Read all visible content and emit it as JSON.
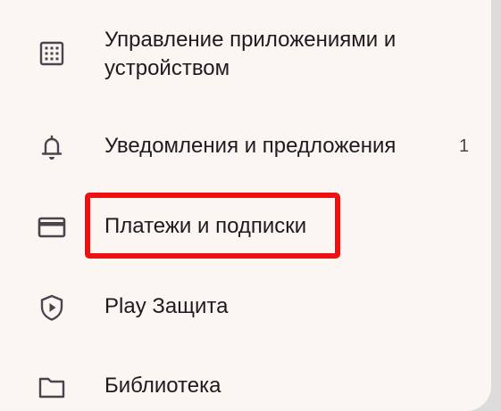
{
  "menu": {
    "items": [
      {
        "id": "apps",
        "label_line1": "Управление приложениями и",
        "label_line2": "устройством",
        "icon": "grid-icon"
      },
      {
        "id": "notifications",
        "label": "Уведомления и предложения",
        "badge": "1",
        "icon": "bell-icon"
      },
      {
        "id": "payments",
        "label": "Платежи и подписки",
        "icon": "credit-card-icon",
        "highlighted": true
      },
      {
        "id": "play-protect",
        "label": "Play Защита",
        "icon": "shield-play-icon"
      },
      {
        "id": "library",
        "label": "Библиотека",
        "icon": "folder-icon"
      }
    ]
  },
  "colors": {
    "background": "#fcf6f3",
    "text": "#1d1b20",
    "icon": "#49454f",
    "highlight": "#ee1111"
  }
}
